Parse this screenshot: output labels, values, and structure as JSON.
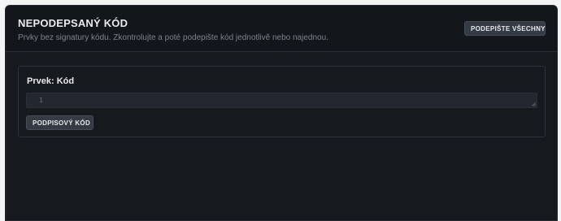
{
  "header": {
    "title": "NEPODEPSANÝ KÓD",
    "subtitle": "Prvky bez signatury kódu. Zkontrolujte a poté podepište kód jednotlivě nebo najednou.",
    "sign_all_label": "PODEPIŠTE VŠECHNY"
  },
  "item": {
    "title": "Prvek: Kód",
    "line_number": "1",
    "code_value": "",
    "sign_label": "PODPISOVÝ KÓD"
  },
  "icons": {
    "sign": "fingerprint-icon"
  },
  "colors": {
    "background": "#161a1e",
    "button": "#353b44",
    "text": "#e8eaed",
    "muted": "#7c838c"
  }
}
